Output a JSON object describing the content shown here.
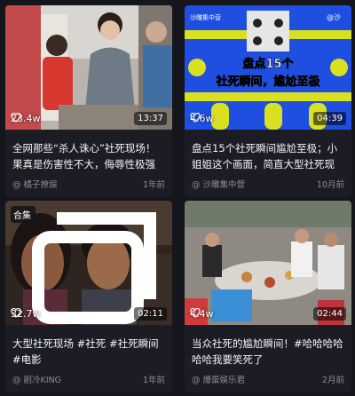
{
  "cards": [
    {
      "likes": "23.4w",
      "duration": "13:37",
      "title": "全网那些“杀人诛心”社死现场！果真是伤害性不大，侮辱性极强",
      "author": "@ 橘子撩娱",
      "date": "1年前",
      "thumb_color": "#b9b4ad"
    },
    {
      "likes": "4.6w",
      "duration": "04:39",
      "overlay_channel": "沙雕集中营",
      "overlay_corner": "@沙",
      "overlay_line1": "盘点15个",
      "overlay_line2": "社死瞬间，尴尬至极",
      "title": "盘点15个社死瞬间尴尬至极；小姐姐这个画面，简直大型社死现场！",
      "author": "@ 沙雕集中营",
      "date": "10月前",
      "thumb_color": "#1f4fe0"
    },
    {
      "badge": "合集",
      "likes": "32.7w",
      "duration": "02:11",
      "title": "大型社死现场 #社死 #社死瞬间 #电影",
      "author": "@ 剧冷KING",
      "date": "1年前",
      "thumb_color": "#4a3a30"
    },
    {
      "likes": "4.4w",
      "duration": "02:44",
      "title": "当众社死的尴尬瞬间！#哈哈哈哈哈哈我要笑死了",
      "author": "@ 爆蛋娱乐君",
      "date": "2月前",
      "thumb_color": "#8e8a83"
    }
  ]
}
